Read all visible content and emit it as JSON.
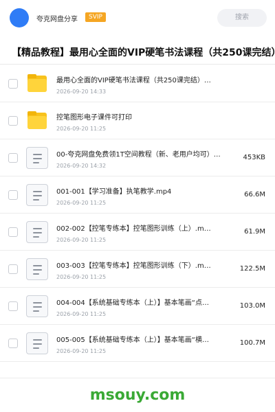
{
  "header": {
    "user_name": "夸克网盘分享",
    "badge": "SVIP",
    "search_placeholder": "搜索"
  },
  "page_title": "【精品教程】最用心全面的VIP硬笔书法课程（共250课完结）",
  "files": [
    {
      "type": "folder",
      "name": "最用心全面的VIP硬笔书法课程（共250课完结）…",
      "date": "2026-09-20 14:33",
      "size": ""
    },
    {
      "type": "folder",
      "name": "控笔图形电子课件可打印",
      "date": "2026-09-20 11:25",
      "size": ""
    },
    {
      "type": "doc",
      "name": "00-夸克网盘免费领1T空间教程（新、老用户均可）…",
      "date": "2026-09-20 14:32",
      "size": "453KB"
    },
    {
      "type": "doc",
      "name": "001-001【学习准备】执笔教学.mp4",
      "date": "2026-09-20 11:25",
      "size": "66.6M"
    },
    {
      "type": "doc",
      "name": "002-002【控笔专练本】控笔图形训练（上）.m…",
      "date": "2026-09-20 11:25",
      "size": "61.9M"
    },
    {
      "type": "doc",
      "name": "003-003【控笔专练本】控笔图形训练（下）.m…",
      "date": "2026-09-20 11:25",
      "size": "122.5M"
    },
    {
      "type": "doc",
      "name": "004-004【系统基础专练本（上）】基本笔画“点…",
      "date": "2026-09-20 11:25",
      "size": "103.0M"
    },
    {
      "type": "doc",
      "name": "005-005【系统基础专练本（上）】基本笔画“横…",
      "date": "2026-09-20 11:25",
      "size": "100.7M"
    }
  ],
  "footer": {
    "watermark": "msouy.com"
  },
  "colors": {
    "accent": "#2f7cf6",
    "badge": "#f5a623",
    "folder": "#ffd43b",
    "watermark": "#3aa935"
  }
}
